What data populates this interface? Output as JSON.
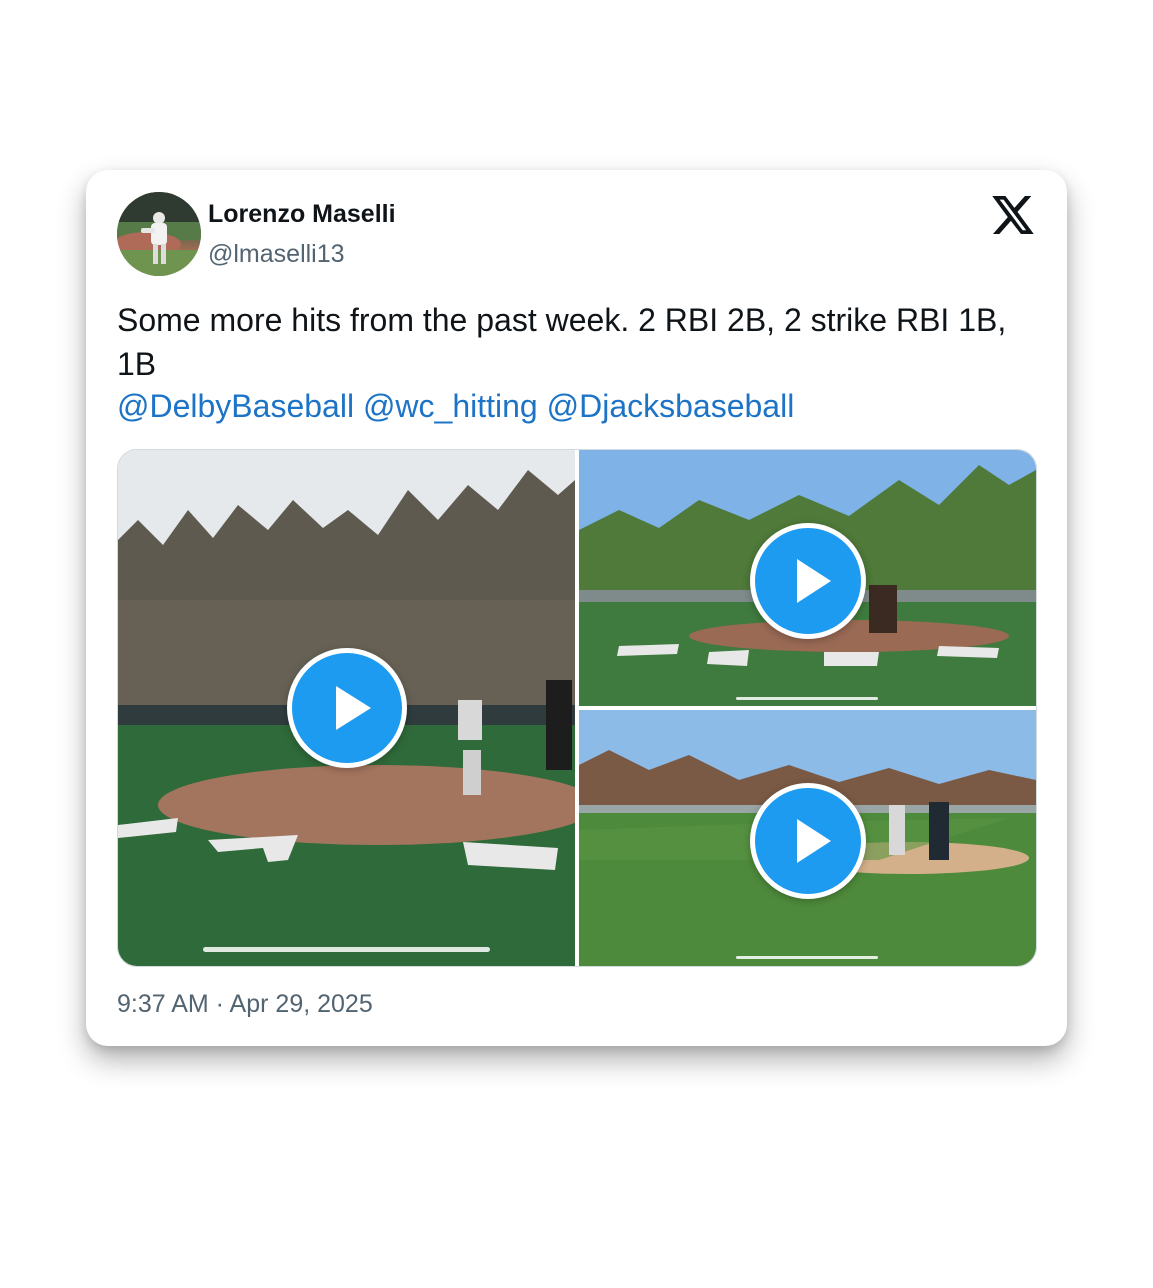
{
  "author": {
    "name": "Lorenzo Maselli",
    "handle": "@lmaselli13"
  },
  "tweet": {
    "text": "Some more hits from the past week. 2 RBI 2B, 2 strike RBI 1B, 1B",
    "mentions": [
      "@DelbyBaseball",
      "@wc_hitting",
      "@Djacksbaseball"
    ],
    "timestamp": "9:37 AM · Apr 29, 2025"
  },
  "media": {
    "videos": [
      {
        "id": "video-1",
        "icon": "play-icon"
      },
      {
        "id": "video-2",
        "icon": "play-icon"
      },
      {
        "id": "video-3",
        "icon": "play-icon"
      }
    ]
  },
  "icons": {
    "brand": "x-logo-icon",
    "play": "play-icon"
  },
  "colors": {
    "link": "#1d74c7",
    "play": "#1d9bf0",
    "text": "#0f1419",
    "muted": "#536471"
  }
}
